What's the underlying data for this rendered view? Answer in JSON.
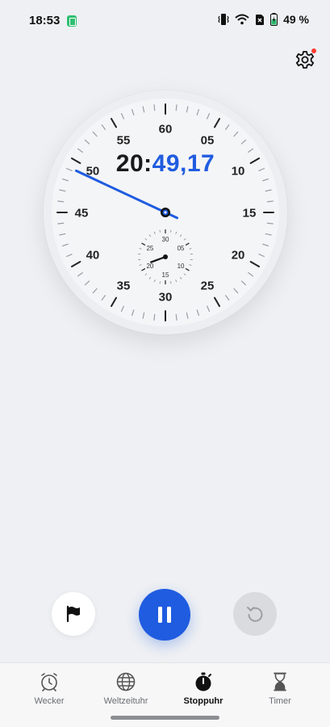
{
  "status_bar": {
    "time": "18:53",
    "battery_text": "49 %",
    "icons": [
      "app-notification-icon",
      "vibrate-icon",
      "wifi-icon",
      "no-sim-icon",
      "battery-charging-icon"
    ]
  },
  "settings": {
    "icon": "gear-icon",
    "has_notification": true
  },
  "stopwatch": {
    "minutes": "20",
    "separator": ":",
    "seconds": "49,17",
    "main_dial_labels": [
      "60",
      "05",
      "10",
      "15",
      "20",
      "25",
      "30",
      "35",
      "40",
      "45",
      "50",
      "55"
    ],
    "sub_dial_labels": [
      "30",
      "05",
      "10",
      "15",
      "20",
      "25"
    ],
    "second_hand_value": 49.17,
    "minute_hand_value": 20.82
  },
  "controls": {
    "lap_icon": "flag-icon",
    "pause_icon": "pause-icon",
    "reset_icon": "reset-icon"
  },
  "nav": {
    "items": [
      {
        "label": "Wecker",
        "icon": "alarm-clock-icon",
        "active": false
      },
      {
        "label": "Weltzeituhr",
        "icon": "globe-icon",
        "active": false
      },
      {
        "label": "Stoppuhr",
        "icon": "stopwatch-icon",
        "active": true
      },
      {
        "label": "Timer",
        "icon": "hourglass-icon",
        "active": false
      }
    ]
  },
  "colors": {
    "accent": "#1f5ce0",
    "background": "#eef0f3",
    "notification": "#ff3b30"
  }
}
